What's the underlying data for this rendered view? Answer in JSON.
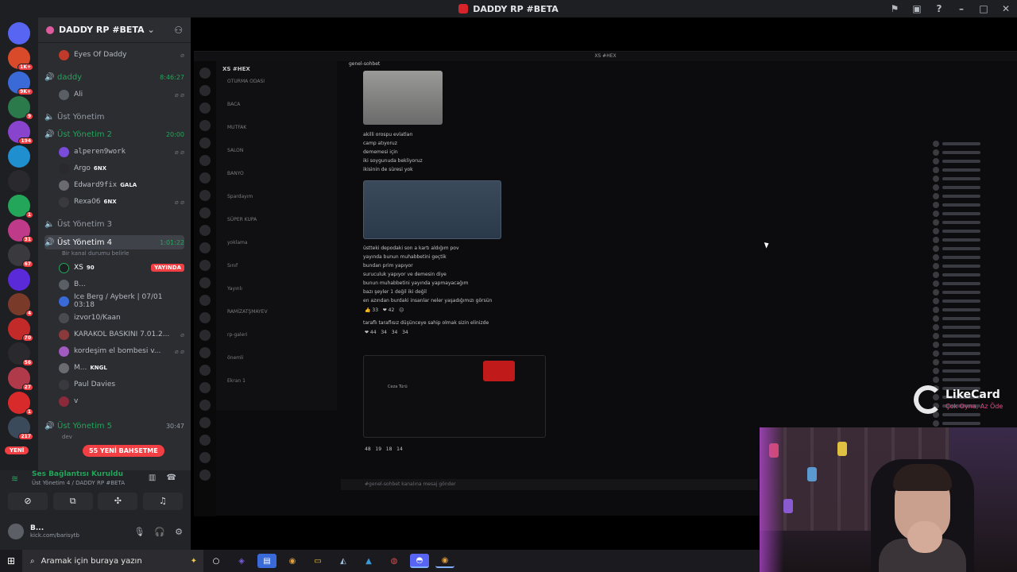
{
  "window": {
    "title": "DADDY RP #BETA"
  },
  "rail": {
    "servers": [
      {
        "color": "#5865f2",
        "badge": ""
      },
      {
        "color": "#d84a2a",
        "badge": "1K+"
      },
      {
        "color": "#3a6ad8",
        "badge": "9K+"
      },
      {
        "color": "#2b7a4b",
        "badge": "9"
      },
      {
        "color": "#8844cc",
        "badge": "194"
      },
      {
        "color": "#1f8fcf",
        "badge": ""
      },
      {
        "color": "#2a2a2e",
        "badge": ""
      },
      {
        "color": "#23a55a",
        "badge": "1"
      },
      {
        "color": "#c03a8a",
        "badge": "31"
      },
      {
        "color": "#3a3a3e",
        "badge": "67"
      },
      {
        "color": "#5a2ad8",
        "badge": ""
      },
      {
        "color": "#7a3a2a",
        "badge": "4"
      },
      {
        "color": "#c22a2a",
        "badge": "70"
      },
      {
        "color": "#2a2a2e",
        "badge": "56"
      },
      {
        "color": "#b03a4a",
        "badge": "27"
      },
      {
        "color": "#d82a2a",
        "badge": "1"
      },
      {
        "color": "#3a4a5a",
        "badge": "217"
      }
    ],
    "yeni_label": "YENİ"
  },
  "sidebar": {
    "guild_name": "DADDY RP #BETA",
    "new_mentions_label": "55 YENİ BAHSETME",
    "channels": [
      {
        "name": "Eyes Of Daddy",
        "kind": "user"
      },
      {
        "name": "daddy",
        "time": "8:46:27",
        "live": true
      },
      {
        "name": "Ali",
        "kind": "user"
      },
      {
        "name": "Üst Yönetim",
        "live": false
      },
      {
        "name": "Üst Yönetim 2",
        "time": "20:00",
        "live": true
      },
      {
        "name": "alperen9work",
        "kind": "user"
      },
      {
        "name": "Argo",
        "tag": "6NX",
        "kind": "user"
      },
      {
        "name": "Edward9fix",
        "tag": "GALA",
        "kind": "user"
      },
      {
        "name": "Rexa06",
        "tag": "6NX",
        "kind": "user"
      },
      {
        "name": "Üst Yönetim 3",
        "live": false
      },
      {
        "name": "Üst Yönetim 4",
        "time": "1:01:22",
        "live": true,
        "sub": "Bir kanal durumu belirle"
      },
      {
        "name": "XS",
        "tag": "90",
        "badge": "YAYINDA",
        "kind": "user"
      },
      {
        "name": "B...",
        "kind": "user"
      },
      {
        "name": "Ice Berg / Ayberk | 07/01 03:18",
        "kind": "user"
      },
      {
        "name": "izvor10/Kaan",
        "kind": "user"
      },
      {
        "name": "KARAKOL BASKINI 7.01.2...",
        "kind": "user"
      },
      {
        "name": "kordeşim el bombesi v...",
        "kind": "user"
      },
      {
        "name": "M...",
        "tag": "KNGL",
        "kind": "user"
      },
      {
        "name": "Paul Davies",
        "kind": "user"
      },
      {
        "name": "v",
        "kind": "user"
      },
      {
        "name": "Üst Yönetim 5",
        "time": "30:47",
        "live": true,
        "sub": "dev"
      }
    ]
  },
  "voice": {
    "status": "Ses Bağlantısı Kuruldu",
    "location": "Üst Yönetim 4 / DADDY RP #BETA",
    "user_name": "B...",
    "user_sub": "kick.com/barisytb"
  },
  "stream": {
    "nested_title": "XS #HEX",
    "nested_server": "XS #HEX",
    "nested_channel": "genel-sohbet",
    "nested_channels": [
      "OTURMA ODASI",
      "BACA",
      "MUTFAK",
      "SALON",
      "BANYO",
      "Spardayım",
      "SÜPER KUPA",
      "yoklama",
      "Sınıf",
      "Yayınlı",
      "RAMİZATŞMAYEV",
      "rp-galeri",
      "önemli",
      "Ekran 1"
    ],
    "messages": [
      "akilli orospu evlatları",
      "camp atıyoruz",
      "dememesi için",
      "iki soygunuda bekliyoruz",
      "ikisinin de süresi yok",
      "üstteki depodaki son a kartı aldığım pov",
      "yayında bunun muhabbetini geçtik",
      "bundan prim yapıyor",
      "suruculuk yapıyor ve demesin diye",
      "bunun muhabbetini yayında yapmayacağım",
      "bazı şeyler 1 değil iki değil",
      "en azından burdaki insanlar neler yaşadığımızı görsün",
      "taraflı taraflısız düşünceye sahip olmak sizin elinizde"
    ],
    "reactions_1": [
      "👍 33",
      "❤ 42",
      "😐"
    ],
    "reactions_2": [
      "❤ 44",
      "34",
      "34",
      "34"
    ],
    "reactions_3": [
      "48",
      "19",
      "18",
      "14"
    ],
    "composer_placeholder": "#genel-sohbet kanalına mesaj gönder",
    "embed_title": "Ceza Türü",
    "sponsor_name": "LikeCard",
    "sponsor_slogan": "Çok Oyna, Az Öde"
  },
  "taskbar": {
    "search_placeholder": "Aramak için buraya yazın"
  },
  "colors": {
    "accent_green": "#23a55a",
    "danger": "#f23f43",
    "sidebar_bg": "#2b2d31"
  }
}
